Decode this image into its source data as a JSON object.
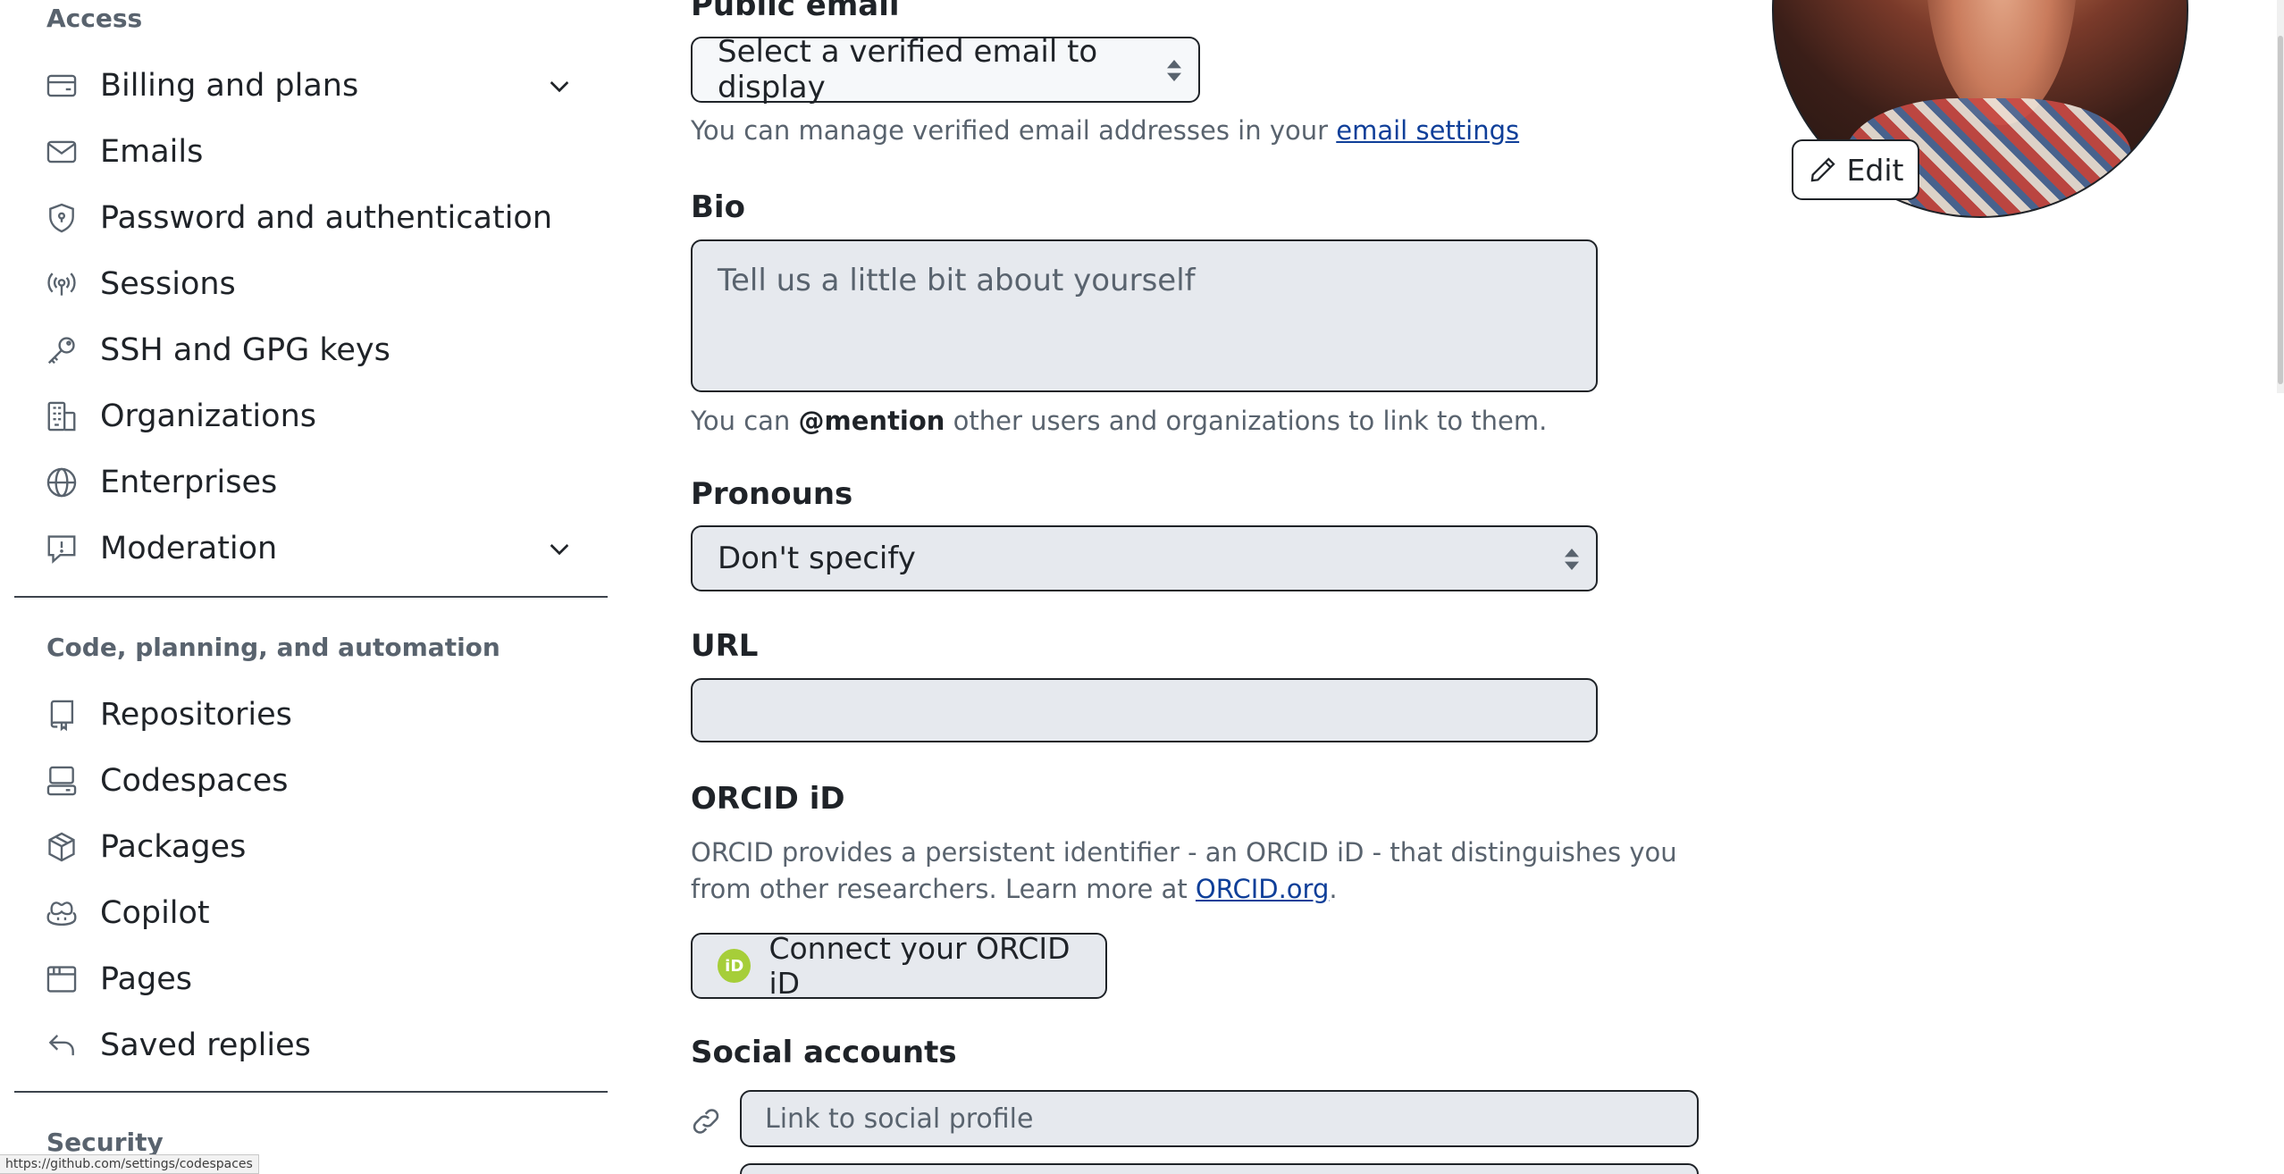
{
  "sidebar": {
    "access_heading": "Access",
    "code_heading": "Code, planning, and automation",
    "security_heading": "Security",
    "access_items": [
      {
        "label": "Billing and plans",
        "icon": "credit-card-icon",
        "expandable": true
      },
      {
        "label": "Emails",
        "icon": "mail-icon"
      },
      {
        "label": "Password and authentication",
        "icon": "shield-lock-icon"
      },
      {
        "label": "Sessions",
        "icon": "broadcast-icon"
      },
      {
        "label": "SSH and GPG keys",
        "icon": "key-icon"
      },
      {
        "label": "Organizations",
        "icon": "organization-icon"
      },
      {
        "label": "Enterprises",
        "icon": "globe-icon"
      },
      {
        "label": "Moderation",
        "icon": "report-icon",
        "expandable": true
      }
    ],
    "code_items": [
      {
        "label": "Repositories",
        "icon": "repo-icon"
      },
      {
        "label": "Codespaces",
        "icon": "codespaces-icon"
      },
      {
        "label": "Packages",
        "icon": "package-icon"
      },
      {
        "label": "Copilot",
        "icon": "copilot-icon"
      },
      {
        "label": "Pages",
        "icon": "browser-icon"
      },
      {
        "label": "Saved replies",
        "icon": "reply-icon"
      }
    ]
  },
  "form": {
    "public_email_label": "Public email",
    "public_email_select": "Select a verified email to display",
    "public_email_note_prefix": "You can manage verified email addresses in your ",
    "public_email_note_link": "email settings",
    "bio_label": "Bio",
    "bio_placeholder": "Tell us a little bit about yourself",
    "bio_note_prefix": "You can ",
    "bio_note_mention": "@mention",
    "bio_note_suffix": " other users and organizations to link to them.",
    "pronouns_label": "Pronouns",
    "pronouns_value": "Don't specify",
    "url_label": "URL",
    "url_value": "",
    "orcid_label": "ORCID iD",
    "orcid_note_prefix": "ORCID provides a persistent identifier - an ORCID iD - that distinguishes you from other researchers. Learn more at ",
    "orcid_note_link": "ORCID.org",
    "orcid_note_suffix": ".",
    "orcid_button": "Connect your ORCID iD",
    "orcid_badge": "iD",
    "social_label": "Social accounts",
    "social_placeholder": "Link to social profile"
  },
  "avatar": {
    "edit_label": "Edit"
  },
  "status_bar": {
    "url": "https://github.com/settings/codespaces"
  },
  "colors": {
    "link": "#0f3f99",
    "orcid_green": "#a6ce39",
    "border": "#1f2328",
    "muted": "#59636e"
  }
}
